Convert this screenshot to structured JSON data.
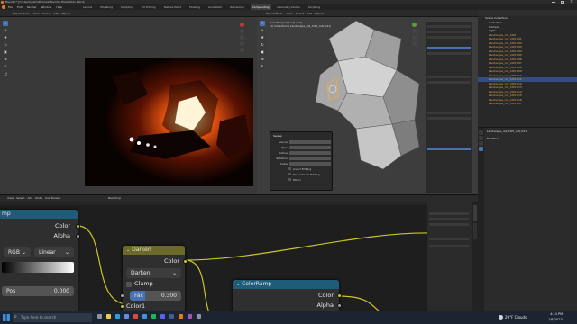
{
  "window": {
    "title": "Blender* [C:\\Users\\Sam\\Pictures\\Blender Files\\tollan.blend]"
  },
  "menu": {
    "items": [
      "File",
      "Edit",
      "Render",
      "Window",
      "Help"
    ],
    "workspaces": [
      "Layout",
      "Modeling",
      "Sculpting",
      "UV Editing",
      "Texture Paint",
      "Shading",
      "Animation",
      "Rendering",
      "Compositing",
      "Geometry Nodes",
      "Scripting"
    ],
    "active_workspace": "Compositing"
  },
  "left_viewport": {
    "mode": "Object Mode",
    "menus": [
      "View",
      "Select",
      "Add",
      "Object"
    ]
  },
  "center_viewport": {
    "mode": "Object Mode",
    "menus": [
      "View",
      "Select",
      "Add",
      "Object"
    ],
    "overlay_title": "User Perspective (Local)",
    "overlay_subtitle": "(1) Collection | Landscape_roll_CO5_cut(.011)",
    "props_title": "Sweep",
    "props_rows": [
      "Source",
      "Type",
      "Active",
      "Rotation",
      "Scale"
    ],
    "props_checks": [
      "Invert Editing",
      "Proportional Editing",
      "Mirror"
    ]
  },
  "outliner": {
    "header": "Scene Collection",
    "rows": [
      "Collection",
      "Camera",
      "Light",
      "Landscape_roll_CO5",
      "Landscape_roll_CO5.001",
      "Landscape_roll_CO5.002",
      "Landscape_roll_CO5.003",
      "Landscape_roll_CO5.004",
      "Landscape_roll_CO5.005",
      "Landscape_roll_CO5.006",
      "Landscape_roll_CO5.007",
      "Landscape_roll_CO5.008",
      "Landscape_roll_CO5.009",
      "Landscape_roll_CO5.010",
      "Landscape_roll_CO5.011",
      "Landscape_roll_CO5.012",
      "Landscape_roll_CO5.013",
      "Landscape_roll_CO5.014",
      "Landscape_roll_CO5.015",
      "Landscape_roll_CO5.016",
      "Landscape_roll_CO5.017"
    ]
  },
  "properties": {
    "object_name": "Landscape_roll_CO5_cut(.011)",
    "section": "Modifiers"
  },
  "compositor": {
    "menus": [
      "View",
      "Select",
      "Add",
      "Node",
      "Use Nodes"
    ],
    "backdrop": "Backdrop"
  },
  "nodes": {
    "left_partial": {
      "header": "mp",
      "color_out": "Color",
      "alpha_out": "Alpha",
      "mode": "RGB",
      "interp": "Linear",
      "pos_label": "Pos",
      "pos_value": "0.000"
    },
    "darken": {
      "title": "Darken",
      "output": "Color",
      "blend_type": "Darken",
      "clamp_label": "Clamp",
      "fac_label": "Fac",
      "fac_value": "0.300",
      "color1": "Color1"
    },
    "colorramp": {
      "title": "ColorRamp",
      "color_out": "Color",
      "alpha_out": "Alpha"
    }
  },
  "taskbar": {
    "search_placeholder": "Type here to search",
    "weather": "29°F  Clouds",
    "time": "4:14 PM",
    "date": "1/8/2023"
  },
  "colors": {
    "accent": "#4772b3",
    "darken_header": "#6b6a2a",
    "colorramp_header": "#1e5d7a",
    "socket_yellow": "#c7c729",
    "socket_gray": "#a1a1a1"
  }
}
